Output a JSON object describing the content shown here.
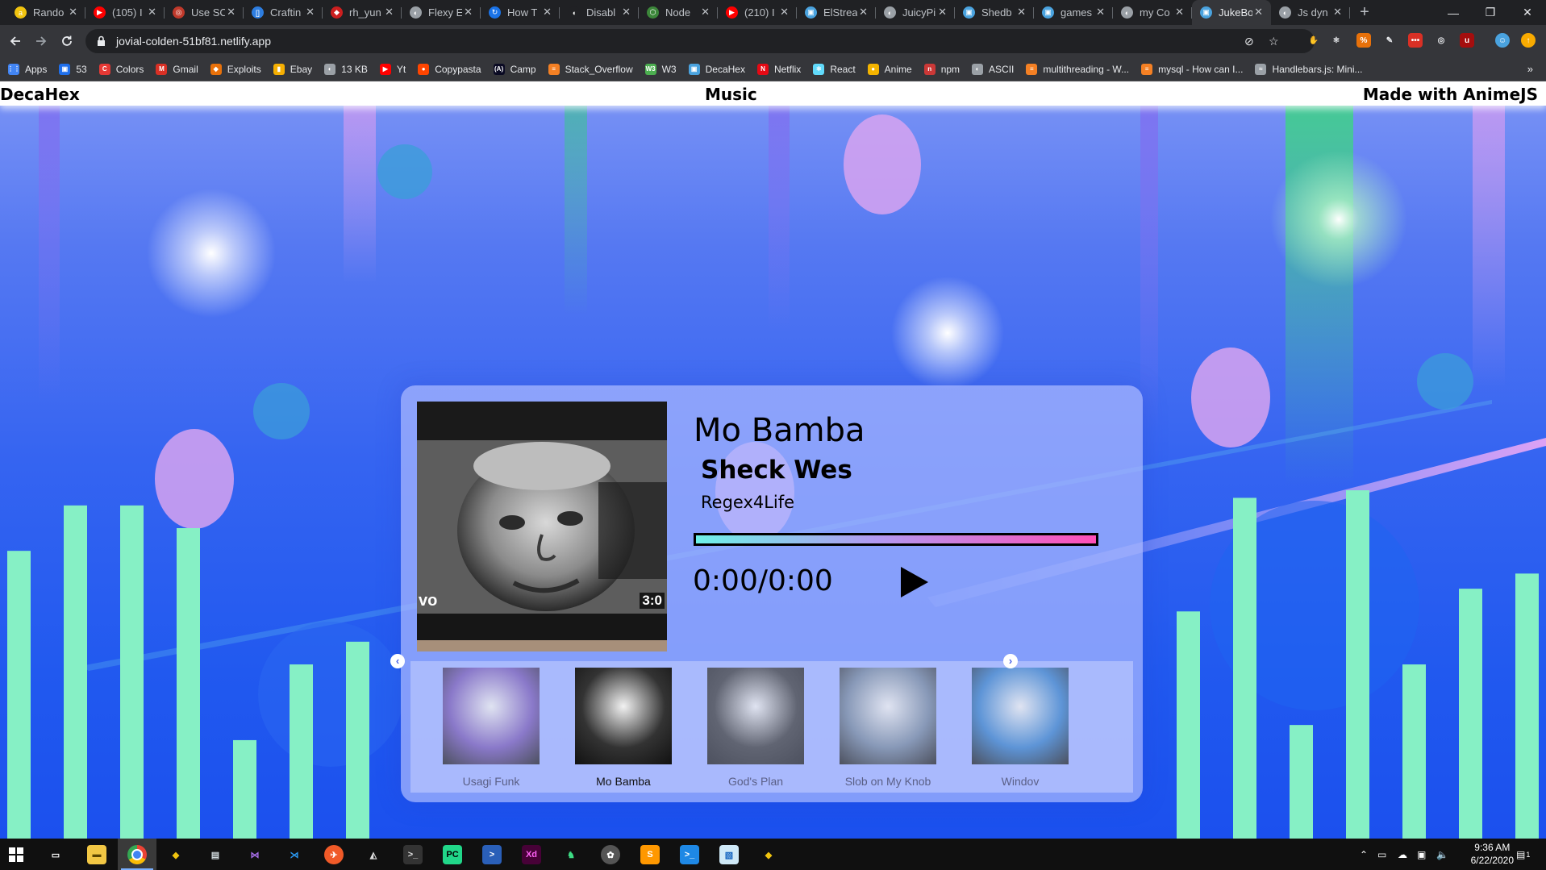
{
  "browser": {
    "tabs": [
      {
        "title": "Rando",
        "favicon_color": "#f1c40f",
        "favicon_glyph": "a"
      },
      {
        "title": "(105) I",
        "favicon_color": "#ff0000",
        "favicon_glyph": "▶"
      },
      {
        "title": "Use SC",
        "favicon_color": "#c0392b",
        "favicon_glyph": "◎"
      },
      {
        "title": "Craftin",
        "favicon_color": "#2d7de0",
        "favicon_glyph": "[]"
      },
      {
        "title": "rh_yun",
        "favicon_color": "#cc1f1f",
        "favicon_glyph": "◆"
      },
      {
        "title": "Flexy E",
        "favicon_color": "#9aa0a6",
        "favicon_glyph": "◐"
      },
      {
        "title": "How T",
        "favicon_color": "#1a73e8",
        "favicon_glyph": "↻"
      },
      {
        "title": "Disabl",
        "favicon_color": "#202124",
        "favicon_glyph": "◖"
      },
      {
        "title": "Node",
        "favicon_color": "#3c873a",
        "favicon_glyph": "⬡"
      },
      {
        "title": "(210) I",
        "favicon_color": "#ff0000",
        "favicon_glyph": "▶"
      },
      {
        "title": "ElStrea",
        "favicon_color": "#4aa3df",
        "favicon_glyph": "▣"
      },
      {
        "title": "JuicyPi",
        "favicon_color": "#9aa0a6",
        "favicon_glyph": "◐"
      },
      {
        "title": "Shedb",
        "favicon_color": "#4aa3df",
        "favicon_glyph": "▣"
      },
      {
        "title": "games",
        "favicon_color": "#4aa3df",
        "favicon_glyph": "▣"
      },
      {
        "title": "my Co",
        "favicon_color": "#9aa0a6",
        "favicon_glyph": "◐"
      },
      {
        "title": "JukeBo",
        "favicon_color": "#4aa3df",
        "favicon_glyph": "▣",
        "active": true
      },
      {
        "title": "Js dyn",
        "favicon_color": "#9aa0a6",
        "favicon_glyph": "◐"
      }
    ],
    "new_tab": "+",
    "window_controls": {
      "minimize": "—",
      "restore": "❐",
      "close": "✕"
    },
    "url": "jovial-colden-51bf81.netlify.app",
    "bookmarks": [
      {
        "label": "Apps",
        "color": "#4285f4",
        "glyph": "⋮⋮"
      },
      {
        "label": "53",
        "color": "#1f6feb",
        "glyph": "▣"
      },
      {
        "label": "Colors",
        "color": "#e53935",
        "glyph": "C"
      },
      {
        "label": "Gmail",
        "color": "#d93025",
        "glyph": "M"
      },
      {
        "label": "Exploits",
        "color": "#e8710a",
        "glyph": "◆"
      },
      {
        "label": "Ebay",
        "color": "#f5af02",
        "glyph": "▮"
      },
      {
        "label": "13 KB",
        "color": "#9aa0a6",
        "glyph": "◐"
      },
      {
        "label": "Yt",
        "color": "#ff0000",
        "glyph": "▶"
      },
      {
        "label": "Copypasta",
        "color": "#ff4500",
        "glyph": "●"
      },
      {
        "label": "Camp",
        "color": "#0a0a23",
        "glyph": "(A)"
      },
      {
        "label": "Stack_Overflow",
        "color": "#f48024",
        "glyph": "≡"
      },
      {
        "label": "W3",
        "color": "#4caf50",
        "glyph": "W3"
      },
      {
        "label": "DecaHex",
        "color": "#4aa3df",
        "glyph": "▣"
      },
      {
        "label": "Netflix",
        "color": "#e50914",
        "glyph": "N"
      },
      {
        "label": "React",
        "color": "#61dafb",
        "glyph": "⚛"
      },
      {
        "label": "Anime",
        "color": "#f4b400",
        "glyph": "●"
      },
      {
        "label": "npm",
        "color": "#cb3837",
        "glyph": "n"
      },
      {
        "label": "ASCII",
        "color": "#9aa0a6",
        "glyph": "◐"
      },
      {
        "label": "multithreading - W...",
        "color": "#f48024",
        "glyph": "≡"
      },
      {
        "label": "mysql - How can I...",
        "color": "#f48024",
        "glyph": "≡"
      },
      {
        "label": "Handlebars.js: Mini...",
        "color": "#9aa0a6",
        "glyph": "≈"
      }
    ],
    "more": "»"
  },
  "site": {
    "brand": "DecaHex",
    "section": "Music",
    "credit": "Made with AnimeJS"
  },
  "player": {
    "title": "Mo Bamba",
    "artist": "Sheck Wes",
    "album": "Regex4Life",
    "time": "0:00/0:00",
    "art_duration_badge": "3:0",
    "art_corner_text": "vo",
    "progress": 0,
    "progress_gradient": [
      "#6ef2e8",
      "#b39af2",
      "#ff4fb7"
    ],
    "queue": [
      {
        "label": "Usagi Funk",
        "art_color": "#6f4fb5",
        "current": false
      },
      {
        "label": "Mo Bamba",
        "art_color": "#333333",
        "current": true
      },
      {
        "label": "God's Plan",
        "art_color": "#2f2f2f",
        "current": false
      },
      {
        "label": "Slob on My Knob",
        "art_color": "#6b7f99",
        "current": false
      },
      {
        "label": "Windov",
        "art_color": "#2b79c9",
        "current": false
      }
    ],
    "prev_arrow": "‹",
    "next_arrow": "›"
  },
  "visualizer": {
    "bar_color": "#86f0c5",
    "bar_levels_left": [
      0.38,
      0.44,
      0.44,
      0.41,
      0.13,
      0.23,
      0.26
    ],
    "bar_levels_right": [
      0.3,
      0.15,
      0.45,
      0.46,
      0.23,
      0.33,
      0.35
    ]
  },
  "taskbar": {
    "time": "9:36 AM",
    "date": "6/22/2020",
    "notification_count": "1"
  }
}
